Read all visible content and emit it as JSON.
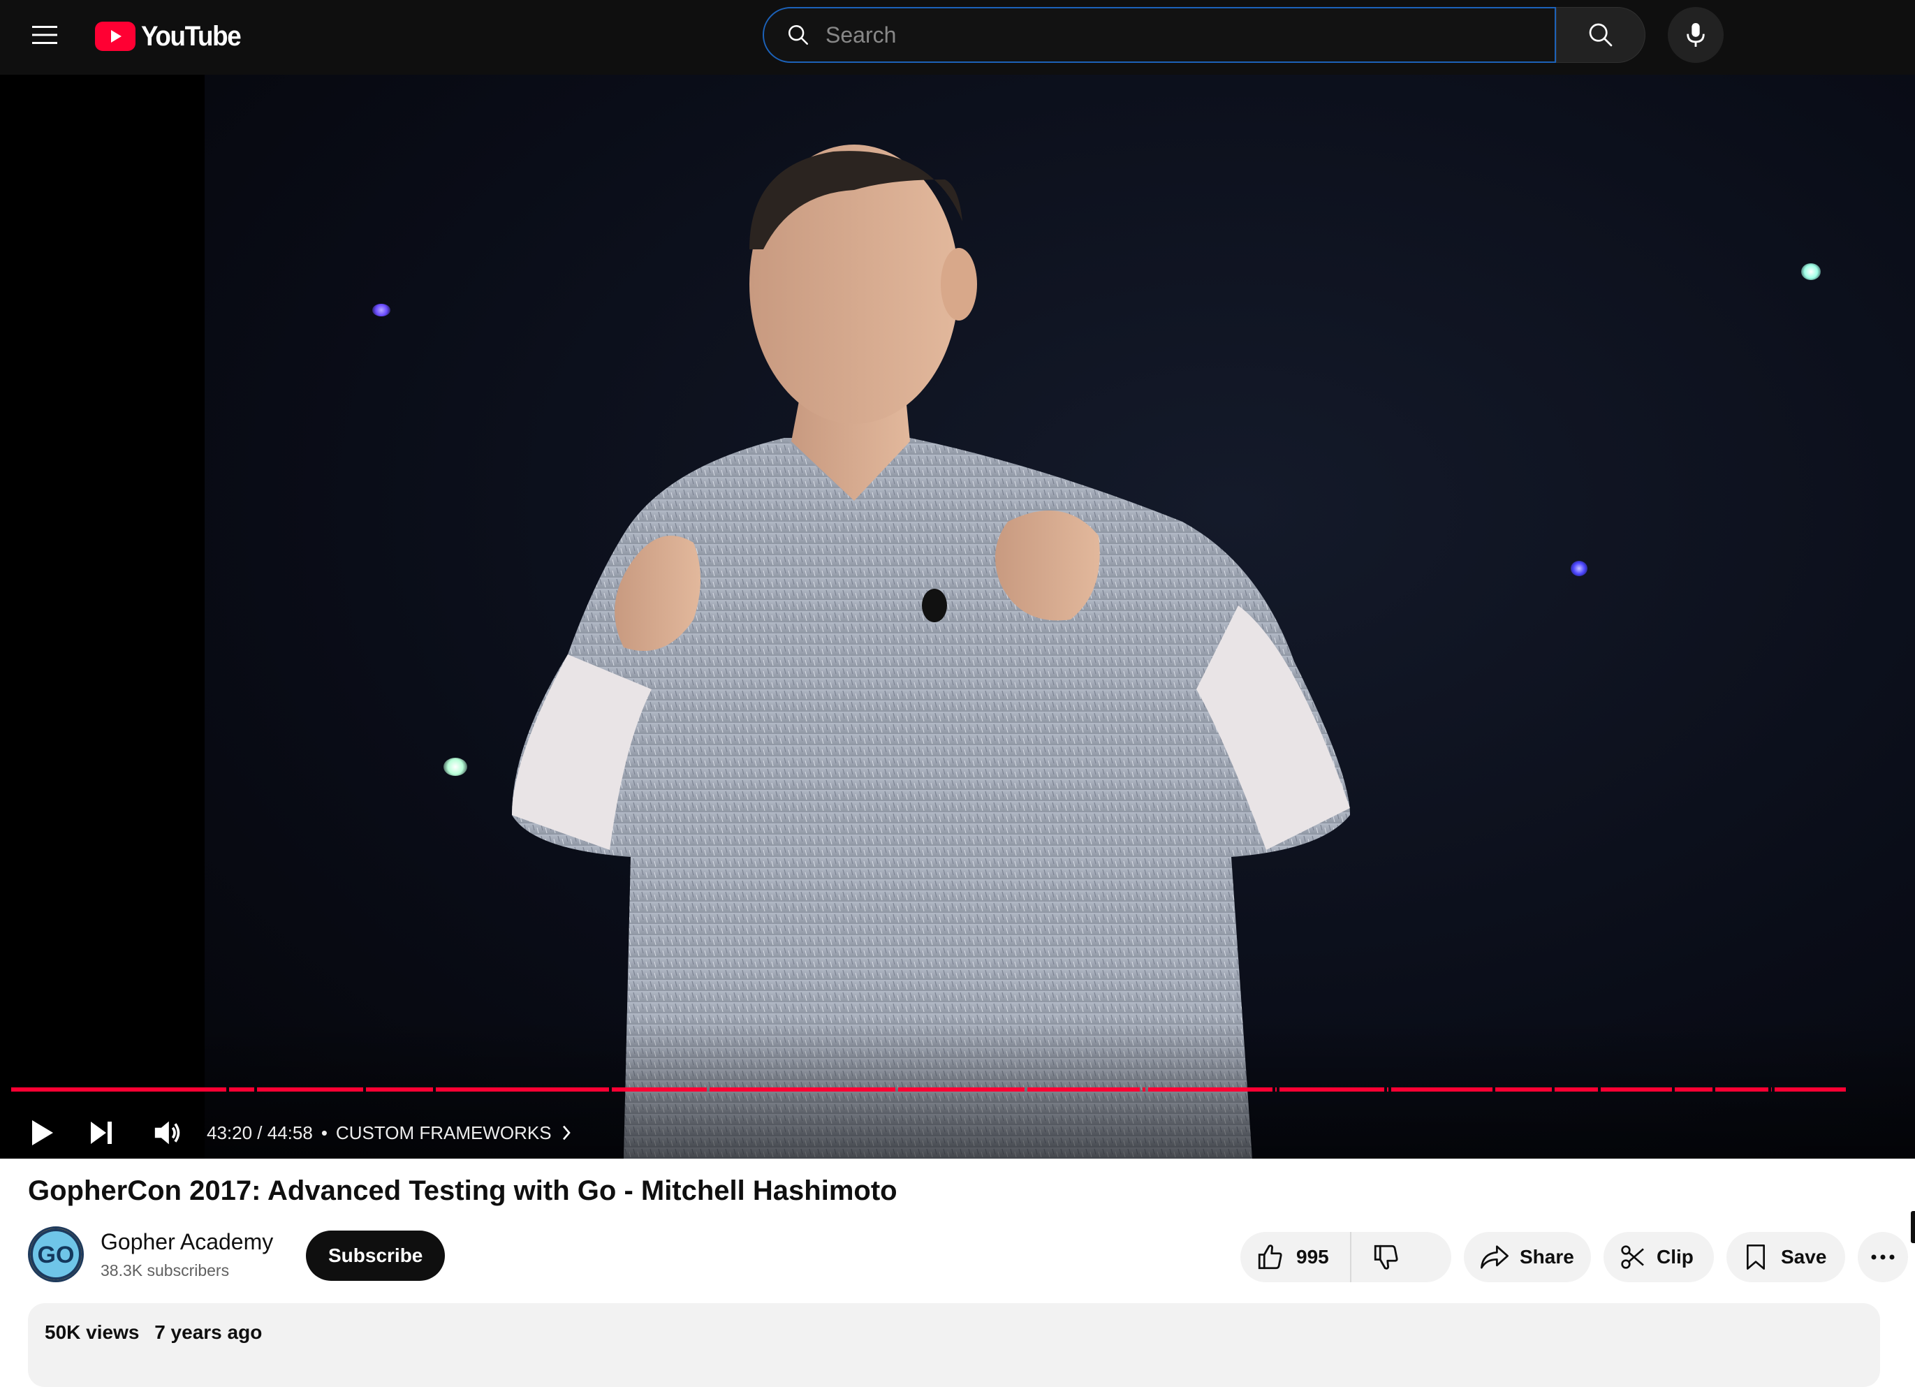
{
  "app": {
    "logo_text": "YouTube",
    "brand_color": "#ff0033"
  },
  "search": {
    "placeholder": "Search",
    "value": ""
  },
  "icons": {
    "menu": "hamburger-menu-icon",
    "search": "magnifier-icon",
    "mic": "microphone-icon",
    "play": "play-icon",
    "next": "skip-next-icon",
    "volume": "volume-icon",
    "chapter": "chevron-right-icon",
    "like": "thumbs-up-icon",
    "dislike": "thumbs-down-icon",
    "share": "share-arrow-icon",
    "clip": "scissors-icon",
    "save": "bookmark-icon",
    "more": "ellipsis-icon"
  },
  "player": {
    "time_display": "43:20 / 44:58",
    "chapter_separator": "•",
    "chapter_title": "CUSTOM FRAMEWORKS",
    "progress_fraction": 0.9637,
    "progress_color": "#ff0033"
  },
  "video": {
    "title": "GopherCon 2017: Advanced Testing with Go - Mitchell Hashimoto",
    "views": "50K views",
    "age": "7 years ago"
  },
  "channel": {
    "name": "Gopher Academy",
    "subscribers": "38.3K subscribers",
    "avatar_text": "GO"
  },
  "actions": {
    "subscribe": "Subscribe",
    "like_count": "995",
    "share": "Share",
    "clip": "Clip",
    "save": "Save"
  }
}
